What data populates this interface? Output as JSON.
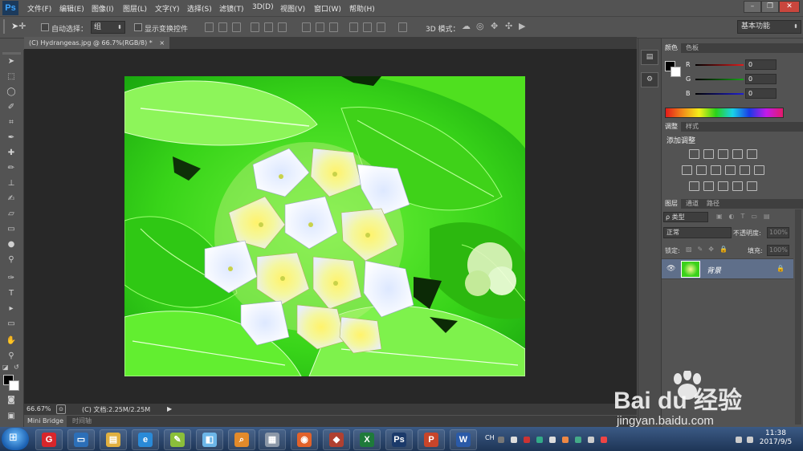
{
  "app": {
    "logo": "Ps"
  },
  "menu": [
    "文件(F)",
    "编辑(E)",
    "图像(I)",
    "图层(L)",
    "文字(Y)",
    "选择(S)",
    "滤镜(T)",
    "3D(D)",
    "视图(V)",
    "窗口(W)",
    "帮助(H)"
  ],
  "window_controls": {
    "minimize": "–",
    "restore": "❐",
    "close": "✕"
  },
  "options": {
    "auto_select_label": "自动选择：",
    "auto_select_value": "组",
    "show_transform_label": "显示变换控件",
    "mode_3d_label": "3D 模式：",
    "workspace": "基本功能"
  },
  "document": {
    "tab_title": "(C) Hydrangeas.jpg @ 66.7%(RGB/8) *",
    "close_glyph": "×",
    "zoom": "66.67%",
    "doc_info": "(C) 文档:2.25M/2.25M"
  },
  "bottom_tabs": [
    "Mini Bridge",
    "时间轴"
  ],
  "color_panel": {
    "tabs": [
      "颜色",
      "色板"
    ],
    "channels": [
      {
        "label": "R",
        "value": "0",
        "color": "#d31e1e"
      },
      {
        "label": "G",
        "value": "0",
        "color": "#18a218"
      },
      {
        "label": "B",
        "value": "0",
        "color": "#1f1fd4"
      }
    ]
  },
  "adjust_panel": {
    "tabs": [
      "调整",
      "样式"
    ],
    "title": "添加调整"
  },
  "layers_panel": {
    "tabs": [
      "图层",
      "通道",
      "路径"
    ],
    "filter_kind": "ρ 类型",
    "blend_mode": "正常",
    "opacity_label": "不透明度:",
    "opacity_value": "100%",
    "lock_label": "锁定:",
    "fill_label": "填充:",
    "fill_value": "100%",
    "layers": [
      {
        "name": "背景",
        "visible": true,
        "locked": true
      }
    ]
  },
  "taskbar": {
    "clock_time": "11:38",
    "clock_date": "2017/9/5",
    "apps": [
      {
        "name": "360-icon",
        "color": "#d8262b",
        "glyph": "G"
      },
      {
        "name": "computer-icon",
        "color": "#2c6fb8",
        "glyph": "▭"
      },
      {
        "name": "explorer-icon",
        "color": "#e0b040",
        "glyph": "▤"
      },
      {
        "name": "ie-icon",
        "color": "#2a8ad8",
        "glyph": "e"
      },
      {
        "name": "paint-icon",
        "color": "#8bbf3a",
        "glyph": "✎"
      },
      {
        "name": "window-icon",
        "color": "#6cb6e8",
        "glyph": "◧"
      },
      {
        "name": "search-app-icon",
        "color": "#e28a2a",
        "glyph": "⌕"
      },
      {
        "name": "calculator-icon",
        "color": "#8c98a8",
        "glyph": "▦"
      },
      {
        "name": "firefox-icon",
        "color": "#e2622a",
        "glyph": "◉"
      },
      {
        "name": "media-icon",
        "color": "#b04030",
        "glyph": "◆"
      },
      {
        "name": "excel-icon",
        "color": "#1e7a3a",
        "glyph": "X"
      },
      {
        "name": "photoshop-icon",
        "color": "#1b3a6a",
        "glyph": "Ps"
      },
      {
        "name": "powerpoint-icon",
        "color": "#c8452a",
        "glyph": "P"
      },
      {
        "name": "word-icon",
        "color": "#2a5aa8",
        "glyph": "W"
      }
    ],
    "ime": "CH"
  },
  "watermark": {
    "brand": "Bai du 经验",
    "url": "jingyan.baidu.com"
  }
}
